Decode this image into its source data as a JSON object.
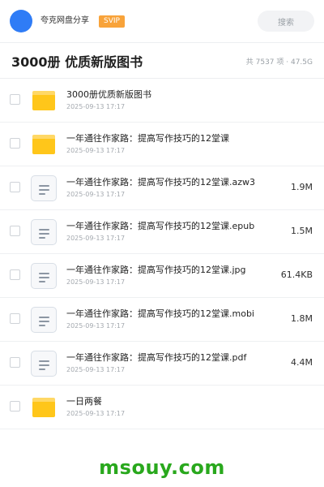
{
  "header": {
    "app_title": "夸克网盘分享",
    "badge": "SVIP",
    "search_placeholder": "搜索",
    "colors": {
      "avatar": "#2f7cf6",
      "badge": "#f8a33a"
    }
  },
  "folder": {
    "title": "3000册 优质新版图书",
    "meta": "共 7537 项 · 47.5G"
  },
  "files": [
    {
      "name": "3000册优质新版图书",
      "date": "2025-09-13 17:17",
      "size": "",
      "type": "folder-icon"
    },
    {
      "name": "一年通往作家路：提高写作技巧的12堂课",
      "date": "2025-09-13 17:17",
      "size": "",
      "type": "folder-icon"
    },
    {
      "name": "一年通往作家路：提高写作技巧的12堂课.azw3",
      "date": "2025-09-13 17:17",
      "size": "1.9M",
      "type": "document-icon"
    },
    {
      "name": "一年通往作家路：提高写作技巧的12堂课.epub",
      "date": "2025-09-13 17:17",
      "size": "1.5M",
      "type": "document-icon"
    },
    {
      "name": "一年通往作家路：提高写作技巧的12堂课.jpg",
      "date": "2025-09-13 17:17",
      "size": "61.4KB",
      "type": "document-icon"
    },
    {
      "name": "一年通往作家路：提高写作技巧的12堂课.mobi",
      "date": "2025-09-13 17:17",
      "size": "1.8M",
      "type": "document-icon"
    },
    {
      "name": "一年通往作家路：提高写作技巧的12堂课.pdf",
      "date": "2025-09-13 17:17",
      "size": "4.4M",
      "type": "document-icon"
    },
    {
      "name": "一日两餐",
      "date": "2025-09-13 17:17",
      "size": "",
      "type": "folder-icon"
    }
  ],
  "watermark": {
    "text": "msouy.com",
    "color": "#29a81d"
  }
}
